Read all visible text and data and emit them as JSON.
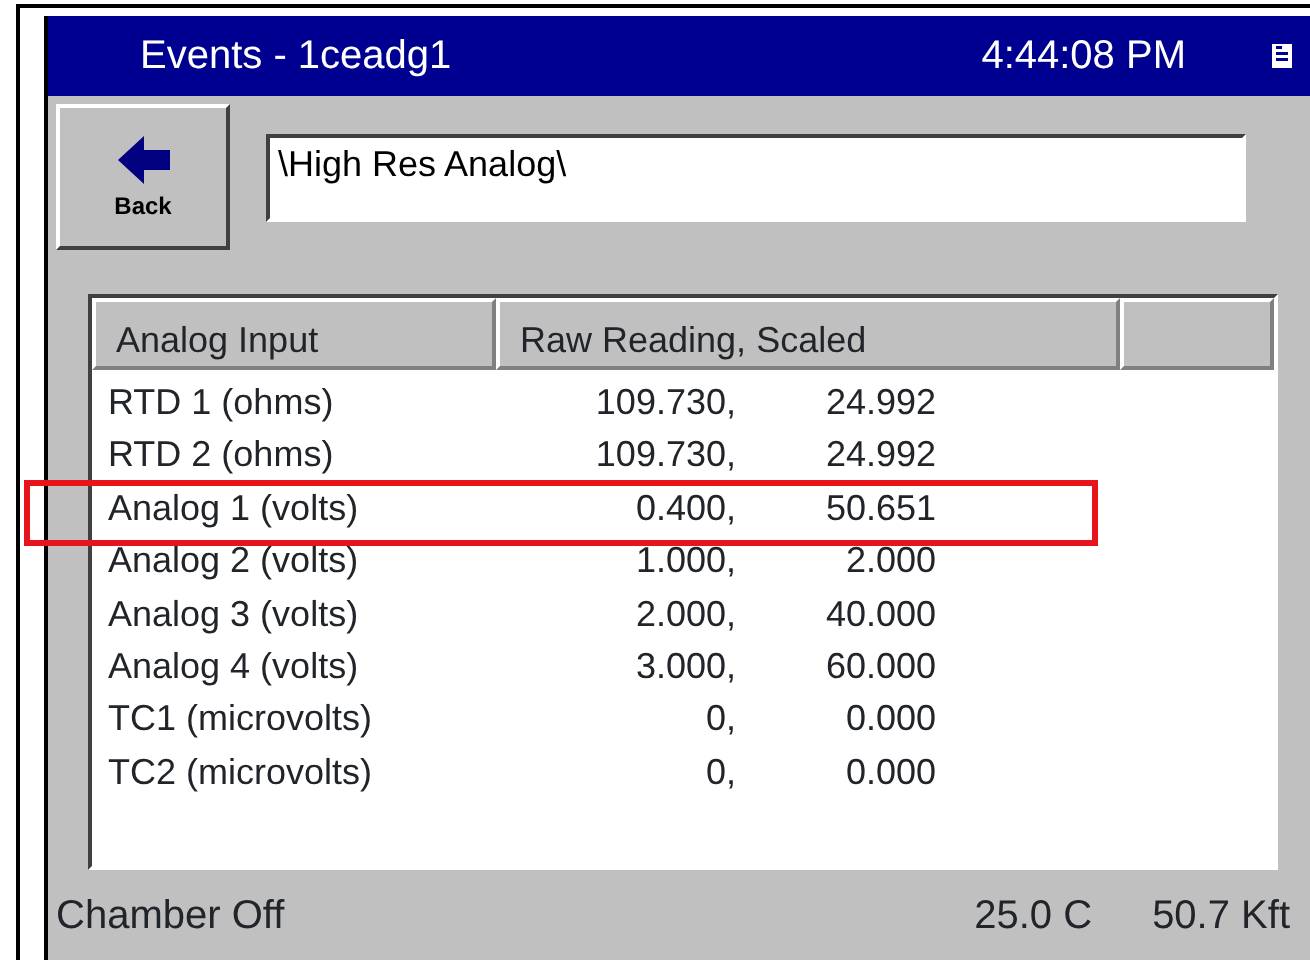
{
  "window": {
    "title": "Events - 1ceadg1",
    "clock": "4:44:08 PM"
  },
  "back_button": {
    "label": "Back"
  },
  "path_field": {
    "value": "\\High Res Analog\\"
  },
  "table": {
    "columns": [
      "Analog Input",
      "Raw Reading, Scaled"
    ],
    "rows": [
      {
        "input": "RTD 1 (ohms)",
        "raw": "109.730,",
        "scaled": "24.992",
        "highlighted": false
      },
      {
        "input": "RTD 2 (ohms)",
        "raw": "109.730,",
        "scaled": "24.992",
        "highlighted": false
      },
      {
        "input": "Analog 1 (volts)",
        "raw": "0.400,",
        "scaled": "50.651",
        "highlighted": true
      },
      {
        "input": "Analog 2 (volts)",
        "raw": "1.000,",
        "scaled": "2.000",
        "highlighted": false
      },
      {
        "input": "Analog 3 (volts)",
        "raw": "2.000,",
        "scaled": "40.000",
        "highlighted": false
      },
      {
        "input": "Analog 4 (volts)",
        "raw": "3.000,",
        "scaled": "60.000",
        "highlighted": false
      },
      {
        "input": "TC1 (microvolts)",
        "raw": "0,",
        "scaled": "0.000",
        "highlighted": false
      },
      {
        "input": "TC2 (microvolts)",
        "raw": "0,",
        "scaled": "0.000",
        "highlighted": false
      }
    ]
  },
  "status_bar": {
    "chamber": "Chamber Off",
    "temperature": "25.0 C",
    "altitude": "50.7 Kft"
  }
}
